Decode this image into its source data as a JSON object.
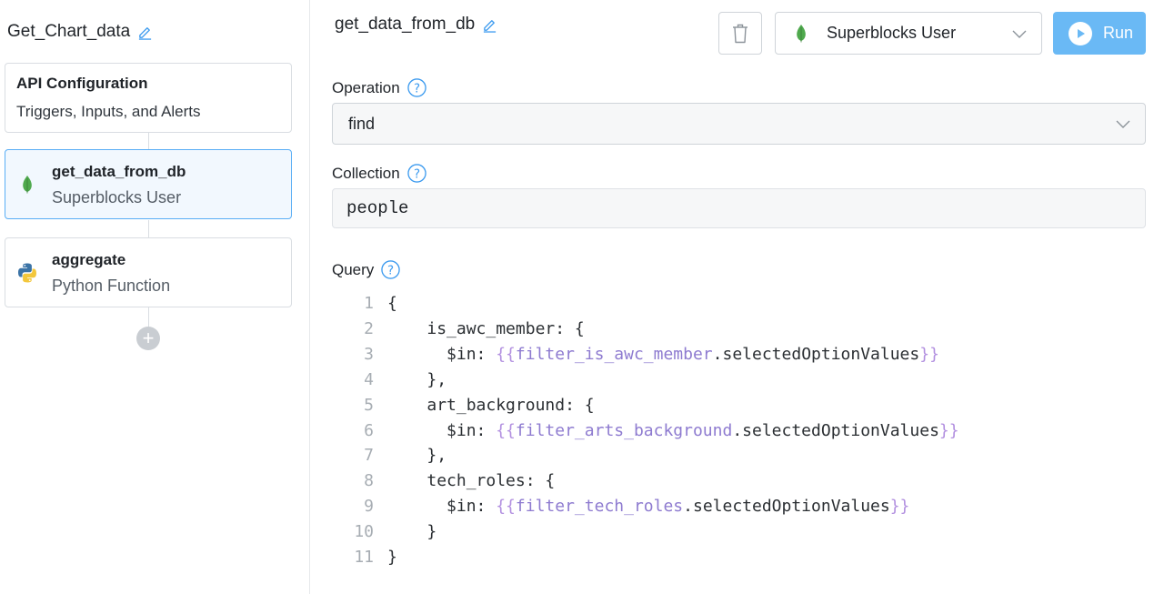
{
  "sidebar": {
    "api_name": "Get_Chart_data",
    "config_card": {
      "title": "API Configuration",
      "subtitle": "Triggers, Inputs, and Alerts"
    },
    "steps": [
      {
        "name": "get_data_from_db",
        "integration": "Superblocks User",
        "icon": "mongodb-leaf-icon"
      },
      {
        "name": "aggregate",
        "integration": "Python Function",
        "icon": "python-icon"
      }
    ]
  },
  "step": {
    "title": "get_data_from_db",
    "integration_select": "Superblocks User",
    "run_label": "Run",
    "operation": {
      "label": "Operation",
      "value": "find"
    },
    "collection": {
      "label": "Collection",
      "value": "people"
    },
    "query": {
      "label": "Query",
      "lines": [
        {
          "n": "1",
          "indent": "",
          "pre": "{",
          "ident": "",
          "post": ""
        },
        {
          "n": "2",
          "indent": "    ",
          "pre": "is_awc_member: {",
          "ident": "",
          "post": ""
        },
        {
          "n": "3",
          "indent": "      ",
          "pre": "$in: ",
          "ident": "filter_is_awc_member",
          "post": ".selectedOptionValues"
        },
        {
          "n": "4",
          "indent": "    ",
          "pre": "},",
          "ident": "",
          "post": ""
        },
        {
          "n": "5",
          "indent": "    ",
          "pre": "art_background: {",
          "ident": "",
          "post": ""
        },
        {
          "n": "6",
          "indent": "      ",
          "pre": "$in: ",
          "ident": "filter_arts_background",
          "post": ".selectedOptionValues"
        },
        {
          "n": "7",
          "indent": "    ",
          "pre": "},",
          "ident": "",
          "post": ""
        },
        {
          "n": "8",
          "indent": "    ",
          "pre": "tech_roles: {",
          "ident": "",
          "post": ""
        },
        {
          "n": "9",
          "indent": "      ",
          "pre": "$in: ",
          "ident": "filter_tech_roles",
          "post": ".selectedOptionValues"
        },
        {
          "n": "10",
          "indent": "    ",
          "pre": "}",
          "ident": "",
          "post": ""
        },
        {
          "n": "11",
          "indent": "",
          "pre": "}",
          "ident": "",
          "post": ""
        }
      ]
    }
  },
  "colors": {
    "accent": "#6ab9f5",
    "active_card_bg": "#f2f8fe",
    "binding_brace": "#b391e0",
    "binding_ident": "#8e7bd0",
    "mongodb_green": "#4fa94d"
  }
}
